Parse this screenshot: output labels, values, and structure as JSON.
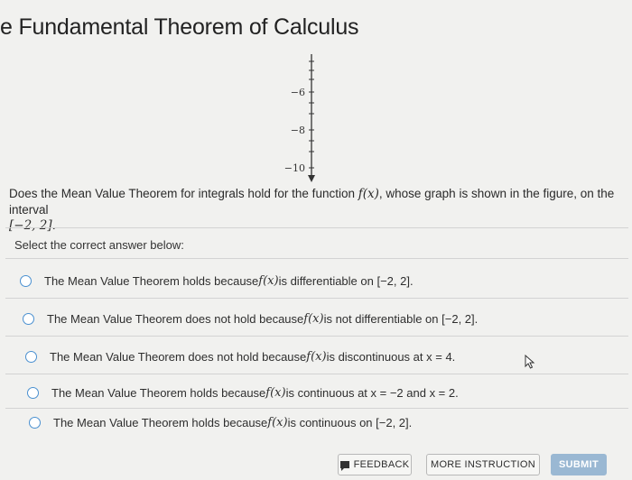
{
  "page": {
    "title": "e Fundamental Theorem of Calculus"
  },
  "figure": {
    "tick_labels": [
      "−6",
      "−8",
      "−10"
    ]
  },
  "question": {
    "part1": "Does the Mean Value Theorem for integrals hold for the function ",
    "func": "f(x)",
    "part2": ", whose graph is shown in the figure, on the interval",
    "interval": "[−2, 2]."
  },
  "prompt": "Select the correct answer below:",
  "options": [
    {
      "pre": "The Mean Value Theorem holds because ",
      "math": "f(x)",
      "post": " is differentiable on [−2, 2]."
    },
    {
      "pre": "The Mean Value Theorem does not hold because ",
      "math": "f(x)",
      "post": " is not differentiable on [−2, 2]."
    },
    {
      "pre": "The Mean Value Theorem does not hold because ",
      "math": "f(x)",
      "post": " is discontinuous at x = 4."
    },
    {
      "pre": "The Mean Value Theorem holds because ",
      "math": "f(x)",
      "post": " is continuous at x = −2 and x = 2."
    },
    {
      "pre": "The Mean Value Theorem holds because ",
      "math": "f(x)",
      "post": " is continuous on [−2, 2]."
    }
  ],
  "footer": {
    "feedback": "FEEDBACK",
    "more_instruction": "MORE INSTRUCTION",
    "submit": "SUBMIT"
  },
  "colors": {
    "radio_border": "#4a90d0",
    "submit_bg": "#9ab8d3"
  }
}
